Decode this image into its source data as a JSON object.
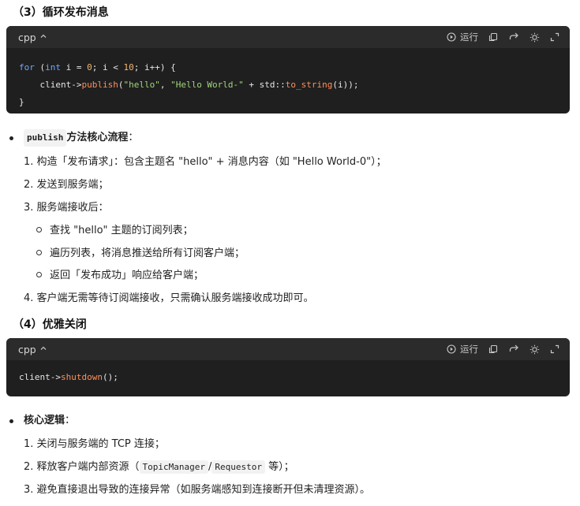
{
  "section3": {
    "title": "（3）循环发布消息",
    "code": {
      "lang": "cpp",
      "run": "运行",
      "line1": {
        "kw_for": "for",
        "p1": " (",
        "kw_int": "int",
        "p2": " i = ",
        "n0": "0",
        "p3": "; i < ",
        "n10": "10",
        "p4": "; i++) {"
      },
      "line2": {
        "indent": "    ",
        "obj": "client->",
        "fn": "publish",
        "p1": "(",
        "s1": "\"hello\"",
        "p2": ", ",
        "s2": "\"Hello World-\"",
        "p3": " + std::",
        "fn2": "to_string",
        "p4": "(i));"
      },
      "line3": "}"
    },
    "bullet": {
      "code": "publish",
      "label": " 方法核心流程",
      "colon": "："
    },
    "items": [
      "1. 构造「发布请求」：包含主题名 \"hello\" + 消息内容（如 \"Hello World-0\"）；",
      "2. 发送到服务端；",
      "3. 服务端接收后："
    ],
    "subitems": [
      "查找 \"hello\" 主题的订阅列表；",
      "遍历列表，将消息推送给所有订阅客户端；",
      "返回「发布成功」响应给客户端；"
    ],
    "item4": "4. 客户端无需等待订阅端接收，只需确认服务端接收成功即可。"
  },
  "section4": {
    "title": "（4）优雅关闭",
    "code": {
      "lang": "cpp",
      "run": "运行",
      "obj": "client->",
      "fn": "shutdown",
      "rest": "();"
    },
    "bullet": {
      "label": "核心逻辑",
      "colon": "："
    },
    "item1": "1. 关闭与服务端的 TCP 连接；",
    "item2": {
      "pre": "2. 释放客户端内部资源（",
      "code1": "TopicManager",
      "sep": "/",
      "code2": "Requestor",
      "post": " 等）；"
    },
    "item3": "3. 避免直接退出导致的连接异常（如服务端感知到连接断开但未清理资源）。"
  },
  "icons": [
    "play-circle-icon",
    "copy-icon",
    "share-arrow-icon",
    "theme-sun-icon",
    "expand-icon",
    "chevron-up-icon"
  ]
}
